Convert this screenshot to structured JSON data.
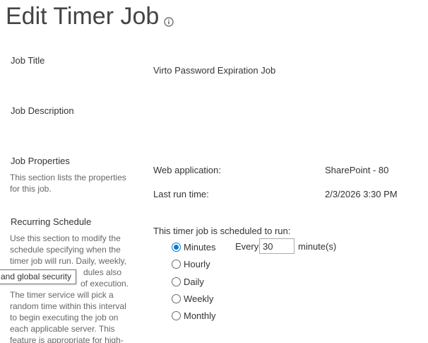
{
  "page": {
    "title": "Edit Timer Job",
    "info_icon": "info-icon"
  },
  "sections": {
    "job_title": {
      "heading": "Job Title",
      "value": "Virto Password Expiration Job"
    },
    "job_description": {
      "heading": "Job Description"
    },
    "job_properties": {
      "heading": "Job Properties",
      "description": "This section lists the properties for this job.",
      "web_application_label": "Web application:",
      "web_application_value": "SharePoint - 80",
      "last_run_label": "Last run time:",
      "last_run_value": "2/3/2026 3:30 PM"
    },
    "recurring_schedule": {
      "heading": "Recurring Schedule",
      "description_lines": [
        "Use this section to modify the",
        "schedule specifying when the",
        "timer job will run. Daily, weekly,",
        "dules also",
        "of execution.",
        "The timer service will pick a",
        "random time within this interval",
        "to begin executing the job on",
        "each applicable server. This",
        "feature is appropriate for high-"
      ],
      "schedule_prompt": "This timer job is scheduled to run:",
      "options": [
        {
          "label": "Minutes",
          "checked": true
        },
        {
          "label": "Hourly",
          "checked": false
        },
        {
          "label": "Daily",
          "checked": false
        },
        {
          "label": "Weekly",
          "checked": false
        },
        {
          "label": "Monthly",
          "checked": false
        }
      ],
      "every_label": "Every",
      "interval_value": "30",
      "interval_unit": "minute(s)"
    }
  },
  "tooltip": {
    "text": "and global security"
  },
  "colors": {
    "accent": "#0078d4",
    "title": "#444444",
    "description": "#666666"
  }
}
